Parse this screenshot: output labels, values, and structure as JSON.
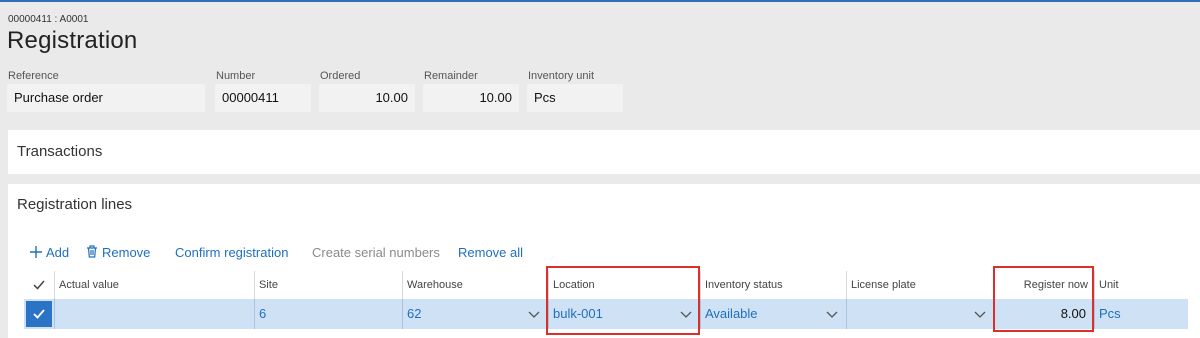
{
  "header": {
    "record_id": "00000411 : A0001",
    "title": "Registration"
  },
  "fields": {
    "reference": {
      "label": "Reference",
      "value": "Purchase order"
    },
    "number": {
      "label": "Number",
      "value": "00000411"
    },
    "ordered": {
      "label": "Ordered",
      "value": "10.00"
    },
    "remainder": {
      "label": "Remainder",
      "value": "10.00"
    },
    "inventory_unit": {
      "label": "Inventory unit",
      "value": "Pcs"
    }
  },
  "sections": {
    "transactions": "Transactions",
    "registration_lines": "Registration lines"
  },
  "toolbar": {
    "add": "Add",
    "remove": "Remove",
    "confirm_registration": "Confirm registration",
    "create_serial_numbers": "Create serial numbers",
    "remove_all": "Remove all"
  },
  "grid": {
    "columns": [
      "Actual value",
      "Site",
      "Warehouse",
      "Location",
      "Inventory status",
      "License plate",
      "Register now",
      "Unit"
    ],
    "rows": [
      {
        "actual_value": "",
        "site": "6",
        "warehouse": "62",
        "location": "bulk-001",
        "inventory_status": "Available",
        "license_plate": "",
        "register_now": "8.00",
        "unit": "Pcs"
      }
    ]
  },
  "colors": {
    "accent": "#1f6fbf",
    "selected_row": "#cfe2f5",
    "highlight": "#d9302c"
  },
  "icons": {
    "add": "plus-icon",
    "remove": "trash-icon",
    "dropdown": "chevron-down-icon",
    "check": "checkmark-icon"
  }
}
